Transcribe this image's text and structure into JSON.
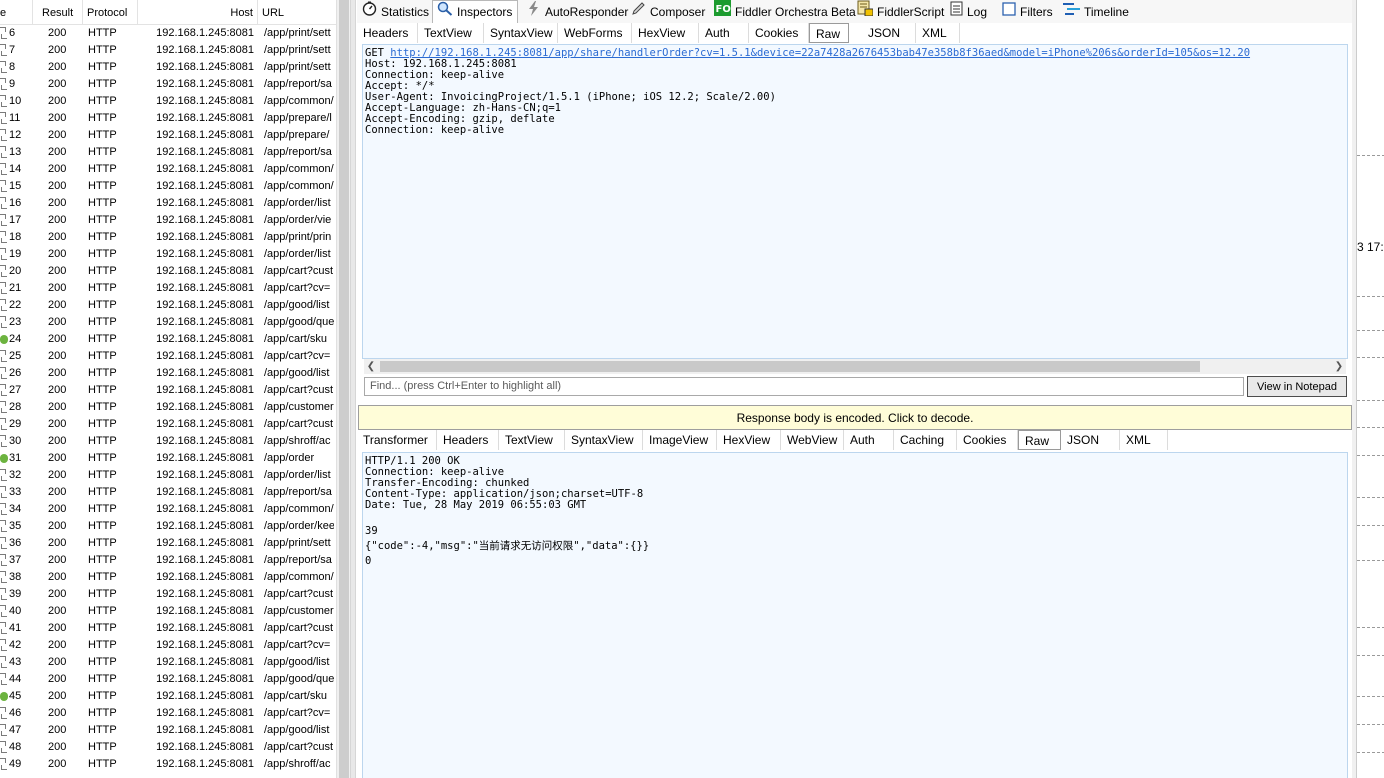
{
  "session_list": {
    "headers": {
      "num": "e",
      "result": "Result",
      "protocol": "Protocol",
      "host": "Host",
      "url": "URL"
    },
    "rows": [
      {
        "num": "6",
        "result": "200",
        "protocol": "HTTP",
        "host": "192.168.1.245:8081",
        "url": "/app/print/sett",
        "icon": "doc"
      },
      {
        "num": "7",
        "result": "200",
        "protocol": "HTTP",
        "host": "192.168.1.245:8081",
        "url": "/app/print/sett",
        "icon": "doc"
      },
      {
        "num": "8",
        "result": "200",
        "protocol": "HTTP",
        "host": "192.168.1.245:8081",
        "url": "/app/print/sett",
        "icon": "doc"
      },
      {
        "num": "9",
        "result": "200",
        "protocol": "HTTP",
        "host": "192.168.1.245:8081",
        "url": "/app/report/sa",
        "icon": "doc"
      },
      {
        "num": "10",
        "result": "200",
        "protocol": "HTTP",
        "host": "192.168.1.245:8081",
        "url": "/app/common/",
        "icon": "doc"
      },
      {
        "num": "11",
        "result": "200",
        "protocol": "HTTP",
        "host": "192.168.1.245:8081",
        "url": "/app/prepare/l",
        "icon": "doc"
      },
      {
        "num": "12",
        "result": "200",
        "protocol": "HTTP",
        "host": "192.168.1.245:8081",
        "url": "/app/prepare/",
        "icon": "doc"
      },
      {
        "num": "13",
        "result": "200",
        "protocol": "HTTP",
        "host": "192.168.1.245:8081",
        "url": "/app/report/sa",
        "icon": "doc"
      },
      {
        "num": "14",
        "result": "200",
        "protocol": "HTTP",
        "host": "192.168.1.245:8081",
        "url": "/app/common/",
        "icon": "doc"
      },
      {
        "num": "15",
        "result": "200",
        "protocol": "HTTP",
        "host": "192.168.1.245:8081",
        "url": "/app/common/",
        "icon": "doc"
      },
      {
        "num": "16",
        "result": "200",
        "protocol": "HTTP",
        "host": "192.168.1.245:8081",
        "url": "/app/order/list",
        "icon": "doc"
      },
      {
        "num": "17",
        "result": "200",
        "protocol": "HTTP",
        "host": "192.168.1.245:8081",
        "url": "/app/order/vie",
        "icon": "doc"
      },
      {
        "num": "18",
        "result": "200",
        "protocol": "HTTP",
        "host": "192.168.1.245:8081",
        "url": "/app/print/prin",
        "icon": "doc"
      },
      {
        "num": "19",
        "result": "200",
        "protocol": "HTTP",
        "host": "192.168.1.245:8081",
        "url": "/app/order/list",
        "icon": "doc"
      },
      {
        "num": "20",
        "result": "200",
        "protocol": "HTTP",
        "host": "192.168.1.245:8081",
        "url": "/app/cart?cust",
        "icon": "doc"
      },
      {
        "num": "21",
        "result": "200",
        "protocol": "HTTP",
        "host": "192.168.1.245:8081",
        "url": "/app/cart?cv=",
        "icon": "doc"
      },
      {
        "num": "22",
        "result": "200",
        "protocol": "HTTP",
        "host": "192.168.1.245:8081",
        "url": "/app/good/list",
        "icon": "doc"
      },
      {
        "num": "23",
        "result": "200",
        "protocol": "HTTP",
        "host": "192.168.1.245:8081",
        "url": "/app/good/que",
        "icon": "doc"
      },
      {
        "num": "24",
        "result": "200",
        "protocol": "HTTP",
        "host": "192.168.1.245:8081",
        "url": "/app/cart/sku",
        "icon": "arrow"
      },
      {
        "num": "25",
        "result": "200",
        "protocol": "HTTP",
        "host": "192.168.1.245:8081",
        "url": "/app/cart?cv=",
        "icon": "doc"
      },
      {
        "num": "26",
        "result": "200",
        "protocol": "HTTP",
        "host": "192.168.1.245:8081",
        "url": "/app/good/list",
        "icon": "doc"
      },
      {
        "num": "27",
        "result": "200",
        "protocol": "HTTP",
        "host": "192.168.1.245:8081",
        "url": "/app/cart?cust",
        "icon": "doc"
      },
      {
        "num": "28",
        "result": "200",
        "protocol": "HTTP",
        "host": "192.168.1.245:8081",
        "url": "/app/customer",
        "icon": "doc"
      },
      {
        "num": "29",
        "result": "200",
        "protocol": "HTTP",
        "host": "192.168.1.245:8081",
        "url": "/app/cart?cust",
        "icon": "doc"
      },
      {
        "num": "30",
        "result": "200",
        "protocol": "HTTP",
        "host": "192.168.1.245:8081",
        "url": "/app/shroff/ac",
        "icon": "doc"
      },
      {
        "num": "31",
        "result": "200",
        "protocol": "HTTP",
        "host": "192.168.1.245:8081",
        "url": "/app/order",
        "icon": "arrow"
      },
      {
        "num": "32",
        "result": "200",
        "protocol": "HTTP",
        "host": "192.168.1.245:8081",
        "url": "/app/order/list",
        "icon": "doc"
      },
      {
        "num": "33",
        "result": "200",
        "protocol": "HTTP",
        "host": "192.168.1.245:8081",
        "url": "/app/report/sa",
        "icon": "doc"
      },
      {
        "num": "34",
        "result": "200",
        "protocol": "HTTP",
        "host": "192.168.1.245:8081",
        "url": "/app/common/",
        "icon": "doc"
      },
      {
        "num": "35",
        "result": "200",
        "protocol": "HTTP",
        "host": "192.168.1.245:8081",
        "url": "/app/order/kee",
        "icon": "doc"
      },
      {
        "num": "36",
        "result": "200",
        "protocol": "HTTP",
        "host": "192.168.1.245:8081",
        "url": "/app/print/sett",
        "icon": "doc"
      },
      {
        "num": "37",
        "result": "200",
        "protocol": "HTTP",
        "host": "192.168.1.245:8081",
        "url": "/app/report/sa",
        "icon": "doc"
      },
      {
        "num": "38",
        "result": "200",
        "protocol": "HTTP",
        "host": "192.168.1.245:8081",
        "url": "/app/common/",
        "icon": "doc"
      },
      {
        "num": "39",
        "result": "200",
        "protocol": "HTTP",
        "host": "192.168.1.245:8081",
        "url": "/app/cart?cust",
        "icon": "doc"
      },
      {
        "num": "40",
        "result": "200",
        "protocol": "HTTP",
        "host": "192.168.1.245:8081",
        "url": "/app/customer",
        "icon": "doc"
      },
      {
        "num": "41",
        "result": "200",
        "protocol": "HTTP",
        "host": "192.168.1.245:8081",
        "url": "/app/cart?cust",
        "icon": "doc"
      },
      {
        "num": "42",
        "result": "200",
        "protocol": "HTTP",
        "host": "192.168.1.245:8081",
        "url": "/app/cart?cv=",
        "icon": "doc"
      },
      {
        "num": "43",
        "result": "200",
        "protocol": "HTTP",
        "host": "192.168.1.245:8081",
        "url": "/app/good/list",
        "icon": "doc"
      },
      {
        "num": "44",
        "result": "200",
        "protocol": "HTTP",
        "host": "192.168.1.245:8081",
        "url": "/app/good/que",
        "icon": "doc"
      },
      {
        "num": "45",
        "result": "200",
        "protocol": "HTTP",
        "host": "192.168.1.245:8081",
        "url": "/app/cart/sku",
        "icon": "arrow"
      },
      {
        "num": "46",
        "result": "200",
        "protocol": "HTTP",
        "host": "192.168.1.245:8081",
        "url": "/app/cart?cv=",
        "icon": "doc"
      },
      {
        "num": "47",
        "result": "200",
        "protocol": "HTTP",
        "host": "192.168.1.245:8081",
        "url": "/app/good/list",
        "icon": "doc"
      },
      {
        "num": "48",
        "result": "200",
        "protocol": "HTTP",
        "host": "192.168.1.245:8081",
        "url": "/app/cart?cust",
        "icon": "doc"
      },
      {
        "num": "49",
        "result": "200",
        "protocol": "HTTP",
        "host": "192.168.1.245:8081",
        "url": "/app/shroff/ac",
        "icon": "doc"
      }
    ]
  },
  "main_tabs": [
    {
      "label": "Statistics",
      "icon": "stopwatch-icon"
    },
    {
      "label": "Inspectors",
      "icon": "inspectors-icon",
      "active": true
    },
    {
      "label": "AutoResponder",
      "icon": "lightning-icon"
    },
    {
      "label": "Composer",
      "icon": "pencil-icon"
    },
    {
      "label": "Fiddler Orchestra Beta",
      "icon": "fo-icon"
    },
    {
      "label": "FiddlerScript",
      "icon": "script-icon"
    },
    {
      "label": "Log",
      "icon": "log-icon"
    },
    {
      "label": "Filters",
      "icon": "checkbox-icon"
    },
    {
      "label": "Timeline",
      "icon": "timeline-icon"
    }
  ],
  "request": {
    "tabs": [
      "Headers",
      "TextView",
      "SyntaxView",
      "WebForms",
      "HexView",
      "Auth",
      "Cookies",
      "Raw",
      "JSON",
      "XML"
    ],
    "active_tab": "Raw",
    "method": "GET ",
    "url": "http://192.168.1.245:8081/app/share/handlerOrder?cv=1.5.1&device=22a7428a2676453bab47e358b8f36aed&model=iPhone%206s&orderId=105&os=12.20",
    "lines": [
      "Host: 192.168.1.245:8081",
      "Connection: keep-alive",
      "Accept: */*",
      "User-Agent: InvoicingProject/1.5.1 (iPhone; iOS 12.2; Scale/2.00)",
      "Accept-Language: zh-Hans-CN;q=1",
      "Accept-Encoding: gzip, deflate",
      "Connection: keep-alive"
    ],
    "find_placeholder": "Find... (press Ctrl+Enter to highlight all)",
    "notepad_button": "View in Notepad"
  },
  "response": {
    "decode_notice": "Response body is encoded. Click to decode.",
    "tabs": [
      "Transformer",
      "Headers",
      "TextView",
      "SyntaxView",
      "ImageView",
      "HexView",
      "WebView",
      "Auth",
      "Caching",
      "Cookies",
      "Raw",
      "JSON",
      "XML"
    ],
    "active_tab": "Raw",
    "lines": [
      "HTTP/1.1 200 OK",
      "Connection: keep-alive",
      "Transfer-Encoding: chunked",
      "Content-Type: application/json;charset=UTF-8",
      "Date: Tue, 28 May 2019 06:55:03 GMT",
      "",
      "39",
      "{\"code\":-4,\"msg\":\"当前请求无访问权限\",\"data\":{}}",
      "0"
    ]
  },
  "background_fragment": "3 17:"
}
